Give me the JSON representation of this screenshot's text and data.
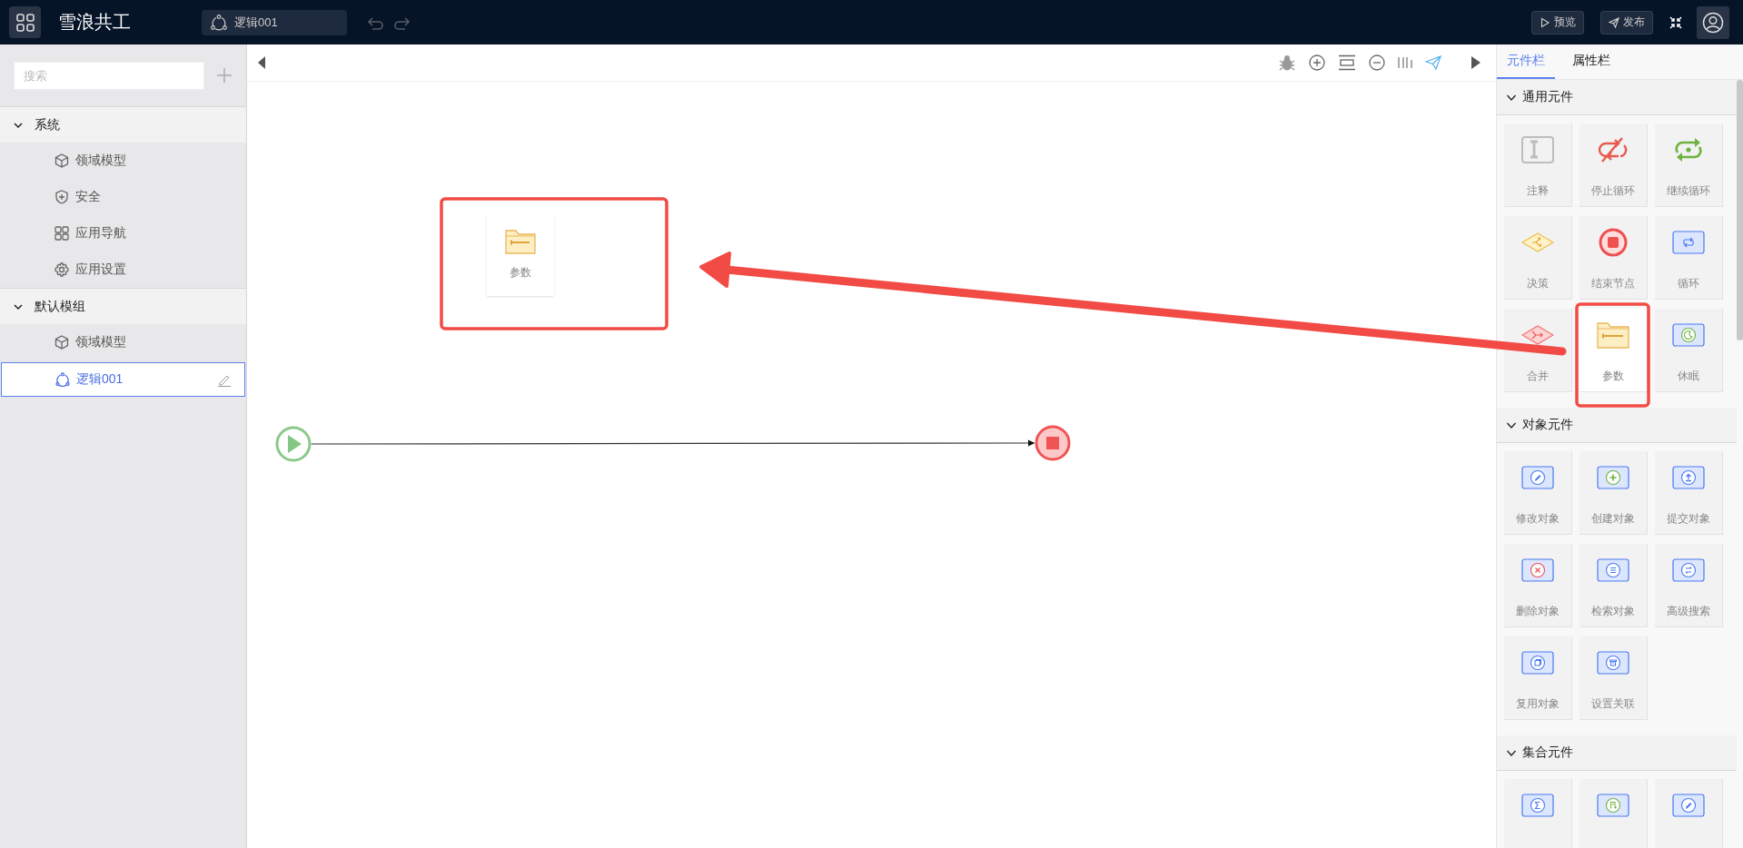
{
  "app": {
    "title": "雪浪共工"
  },
  "top_bar": {
    "tab": {
      "label": "逻辑001"
    },
    "buttons": [
      {
        "label": "预览",
        "kind": "preview"
      },
      {
        "label": "发布",
        "kind": "publish"
      }
    ]
  },
  "sidebar": {
    "search": {
      "placeholder": "搜索"
    },
    "groups": [
      {
        "label": "系统",
        "expanded": true,
        "children": [
          {
            "label": "领域模型",
            "kind": "model",
            "selected": false
          },
          {
            "label": "安全",
            "kind": "security",
            "selected": false
          },
          {
            "label": "应用导航",
            "kind": "navigation",
            "selected": false
          },
          {
            "label": "应用设置",
            "kind": "settings",
            "selected": false
          }
        ]
      },
      {
        "label": "默认模组",
        "expanded": true,
        "children": [
          {
            "label": "领域模型",
            "kind": "model",
            "selected": false
          },
          {
            "label": "逻辑001",
            "kind": "logic",
            "selected": true
          }
        ]
      }
    ]
  },
  "canvas": {
    "nodes": [
      {
        "kind": "param",
        "label": "参数"
      },
      {
        "kind": "start"
      },
      {
        "kind": "end"
      }
    ]
  },
  "panel": {
    "tabs": [
      {
        "label": "元件栏",
        "selected": true
      },
      {
        "label": "属性栏",
        "selected": false
      }
    ],
    "sections": [
      {
        "title": "通用元件",
        "expanded": true,
        "items": [
          {
            "label": "注释",
            "kind": "note",
            "selected": false
          },
          {
            "label": "停止循环",
            "kind": "stop-loop",
            "selected": false
          },
          {
            "label": "继续循环",
            "kind": "continue-loop",
            "selected": false
          },
          {
            "label": "决策",
            "kind": "decision",
            "selected": false
          },
          {
            "label": "结束节点",
            "kind": "end",
            "selected": false
          },
          {
            "label": "循环",
            "kind": "loop",
            "selected": false
          },
          {
            "label": "合并",
            "kind": "merge",
            "selected": false
          },
          {
            "label": "参数",
            "kind": "param",
            "selected": true
          },
          {
            "label": "休眠",
            "kind": "sleep",
            "selected": false
          }
        ]
      },
      {
        "title": "对象元件",
        "expanded": true,
        "items": [
          {
            "label": "修改对象",
            "kind": "edit",
            "selected": false
          },
          {
            "label": "创建对象",
            "kind": "create",
            "selected": false
          },
          {
            "label": "提交对象",
            "kind": "submit",
            "selected": false
          },
          {
            "label": "删除对象",
            "kind": "delete",
            "selected": false
          },
          {
            "label": "检索对象",
            "kind": "retrieve",
            "selected": false
          },
          {
            "label": "高级搜索",
            "kind": "search",
            "selected": false
          },
          {
            "label": "复用对象",
            "kind": "reuse",
            "selected": false
          },
          {
            "label": "设置关联",
            "kind": "relate",
            "selected": false
          }
        ]
      },
      {
        "title": "集合元件",
        "expanded": true,
        "items": [
          {
            "kind": "sum",
            "selected": false
          },
          {
            "kind": "create-list",
            "selected": false
          },
          {
            "kind": "edit",
            "selected": false
          }
        ]
      }
    ]
  }
}
